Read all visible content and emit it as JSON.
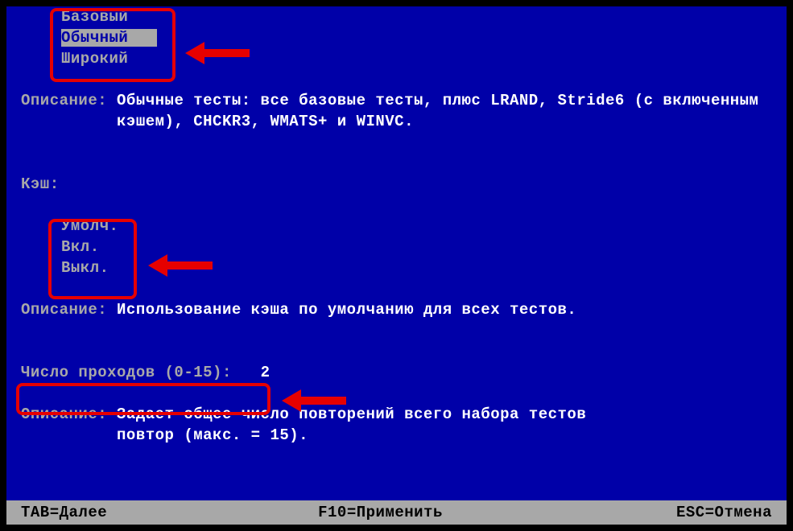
{
  "test_menu": {
    "options": [
      "Базовый",
      "Обычный",
      "Широкий"
    ],
    "selected_index": 1
  },
  "test_desc_label": "Описание:",
  "test_desc_line1": "Обычные тесты: все базовые тесты, плюс LRAND, Stride6 (с включенным",
  "test_desc_line2": "кэшем), CHCKR3, WMATS+ и WINVC.",
  "cache_label": "Кэш:",
  "cache_menu": {
    "options": [
      "Умолч.",
      "Вкл.",
      "Выкл."
    ]
  },
  "cache_desc_label": "Описание:",
  "cache_desc_text": "Использование кэша по умолчанию для всех тестов.",
  "passes_label": "Число проходов (0-15):",
  "passes_value": "2",
  "passes_desc_label": "Описание:",
  "passes_desc_line1": "Задает общее число повторений всего набора тестов",
  "passes_desc_line2": "повтор (макс. = 15).",
  "status": {
    "tab": "TAB=Далее",
    "f10": "F10=Применить",
    "esc": "ESC=Отмена"
  }
}
